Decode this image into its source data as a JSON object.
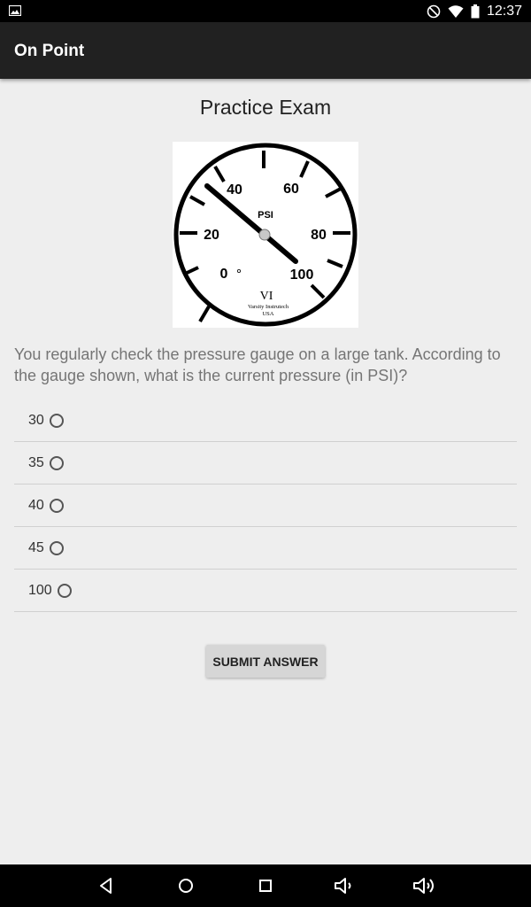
{
  "status_bar": {
    "time": "12:37"
  },
  "app_bar": {
    "title": "On Point"
  },
  "page": {
    "title": "Practice Exam"
  },
  "gauge": {
    "unit": "PSI",
    "scale_labels": [
      "0",
      "20",
      "40",
      "60",
      "80",
      "100"
    ],
    "brand_line1": "Varsity Instrutech",
    "brand_line2": "USA",
    "logo_text": "VI"
  },
  "question": {
    "text": "You regularly check the pressure gauge on a large tank. According to the gauge shown, what is the current pressure (in PSI)?",
    "options": [
      "30",
      "35",
      "40",
      "45",
      "100"
    ]
  },
  "submit_label": "SUBMIT ANSWER"
}
